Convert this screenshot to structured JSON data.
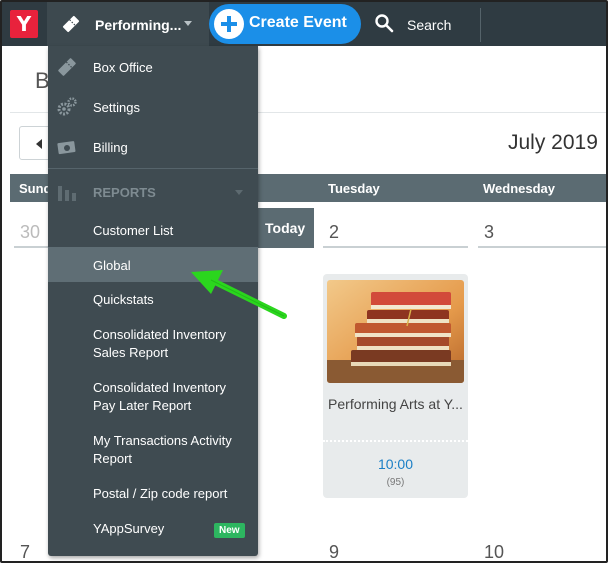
{
  "app": {
    "logo_letter": "Y",
    "brand_color": "#e8223c",
    "accent_color": "#1b8fe8"
  },
  "topbar": {
    "current_tab": "Performing...",
    "create_event_label": "Create Event",
    "search_label": "Search"
  },
  "menu": {
    "items": [
      {
        "label": "Box Office",
        "icon": "ticket-icon"
      },
      {
        "label": "Settings",
        "icon": "gears-icon"
      },
      {
        "label": "Billing",
        "icon": "money-icon"
      }
    ],
    "reports_header": "REPORTS",
    "reports": [
      {
        "label": "Customer List"
      },
      {
        "label": "Global",
        "active": true
      },
      {
        "label": "Quickstats"
      },
      {
        "label": "Consolidated Inventory Sales Report"
      },
      {
        "label": "Consolidated Inventory Pay Later Report"
      },
      {
        "label": "My Transactions Activity Report"
      },
      {
        "label": "Postal / Zip code report"
      },
      {
        "label": "YAppSurvey",
        "badge": "New"
      }
    ]
  },
  "calendar": {
    "page_title_partial": "B",
    "month": "July 2019",
    "day_headers": [
      "Sund",
      "Tuesday",
      "Wednesday"
    ],
    "today_label": "Today",
    "week1_dates": [
      "30",
      "2",
      "3"
    ],
    "week2_dates": [
      "7",
      "9",
      "10"
    ],
    "event": {
      "title": "Performing Arts at Y...",
      "time": "10:00",
      "count": "(95)"
    }
  }
}
